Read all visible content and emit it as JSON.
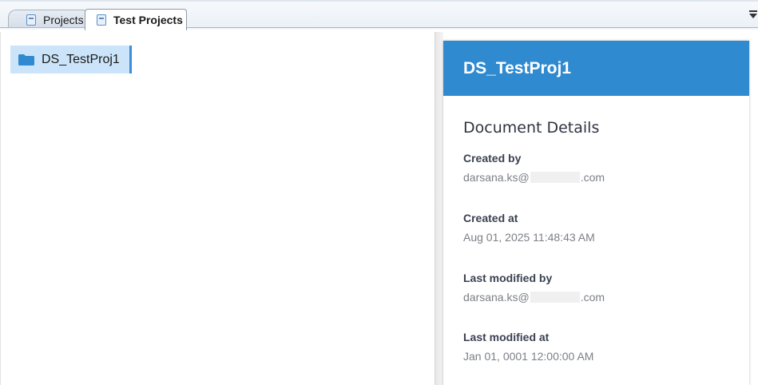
{
  "tabs": [
    {
      "label": "Projects",
      "active": false
    },
    {
      "label": "Test Projects",
      "active": true
    }
  ],
  "tree": {
    "items": [
      {
        "label": "DS_TestProj1",
        "selected": true
      }
    ]
  },
  "details": {
    "header_title": "DS_TestProj1",
    "section_title": "Document Details",
    "fields": [
      {
        "label": "Created by",
        "value_prefix": "darsana.ks@",
        "value_suffix": ".com"
      },
      {
        "label": "Created at",
        "value": "Aug 01, 2025 11:48:43 AM"
      },
      {
        "label": "Last modified by",
        "value_prefix": "darsana.ks@",
        "value_suffix": ".com"
      },
      {
        "label": "Last modified at",
        "value": "Jan 01, 0001 12:00:00 AM"
      }
    ]
  },
  "colors": {
    "header_blue": "#2f8ad0",
    "selection": "#cce4f9",
    "selection_border": "#3b8fd9"
  }
}
